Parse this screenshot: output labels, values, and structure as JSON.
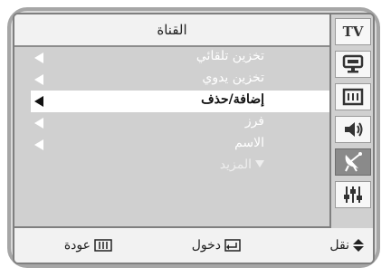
{
  "sidebar": {
    "tv_label": "TV",
    "icons": [
      {
        "name": "picture-icon",
        "active": false
      },
      {
        "name": "sound-icon",
        "active": false
      },
      {
        "name": "speaker-icon",
        "active": false
      },
      {
        "name": "satellite-icon",
        "active": true
      },
      {
        "name": "settings-sliders-icon",
        "active": false
      }
    ]
  },
  "menu": {
    "title": "القناة",
    "items": [
      {
        "label": "تخزين تلقائي"
      },
      {
        "label": "تخزين يدوي"
      },
      {
        "label": "إضافة/حذف"
      },
      {
        "label": "فرز"
      },
      {
        "label": "الاسم"
      }
    ],
    "more_label": "المزيد"
  },
  "footer": {
    "move_label": "نقل",
    "enter_label": "دخول",
    "return_label": "عودة"
  },
  "colors": {
    "highlight": "#ffffff",
    "panel": "#d0d0d0",
    "active_icon": "#8a8a8a"
  }
}
